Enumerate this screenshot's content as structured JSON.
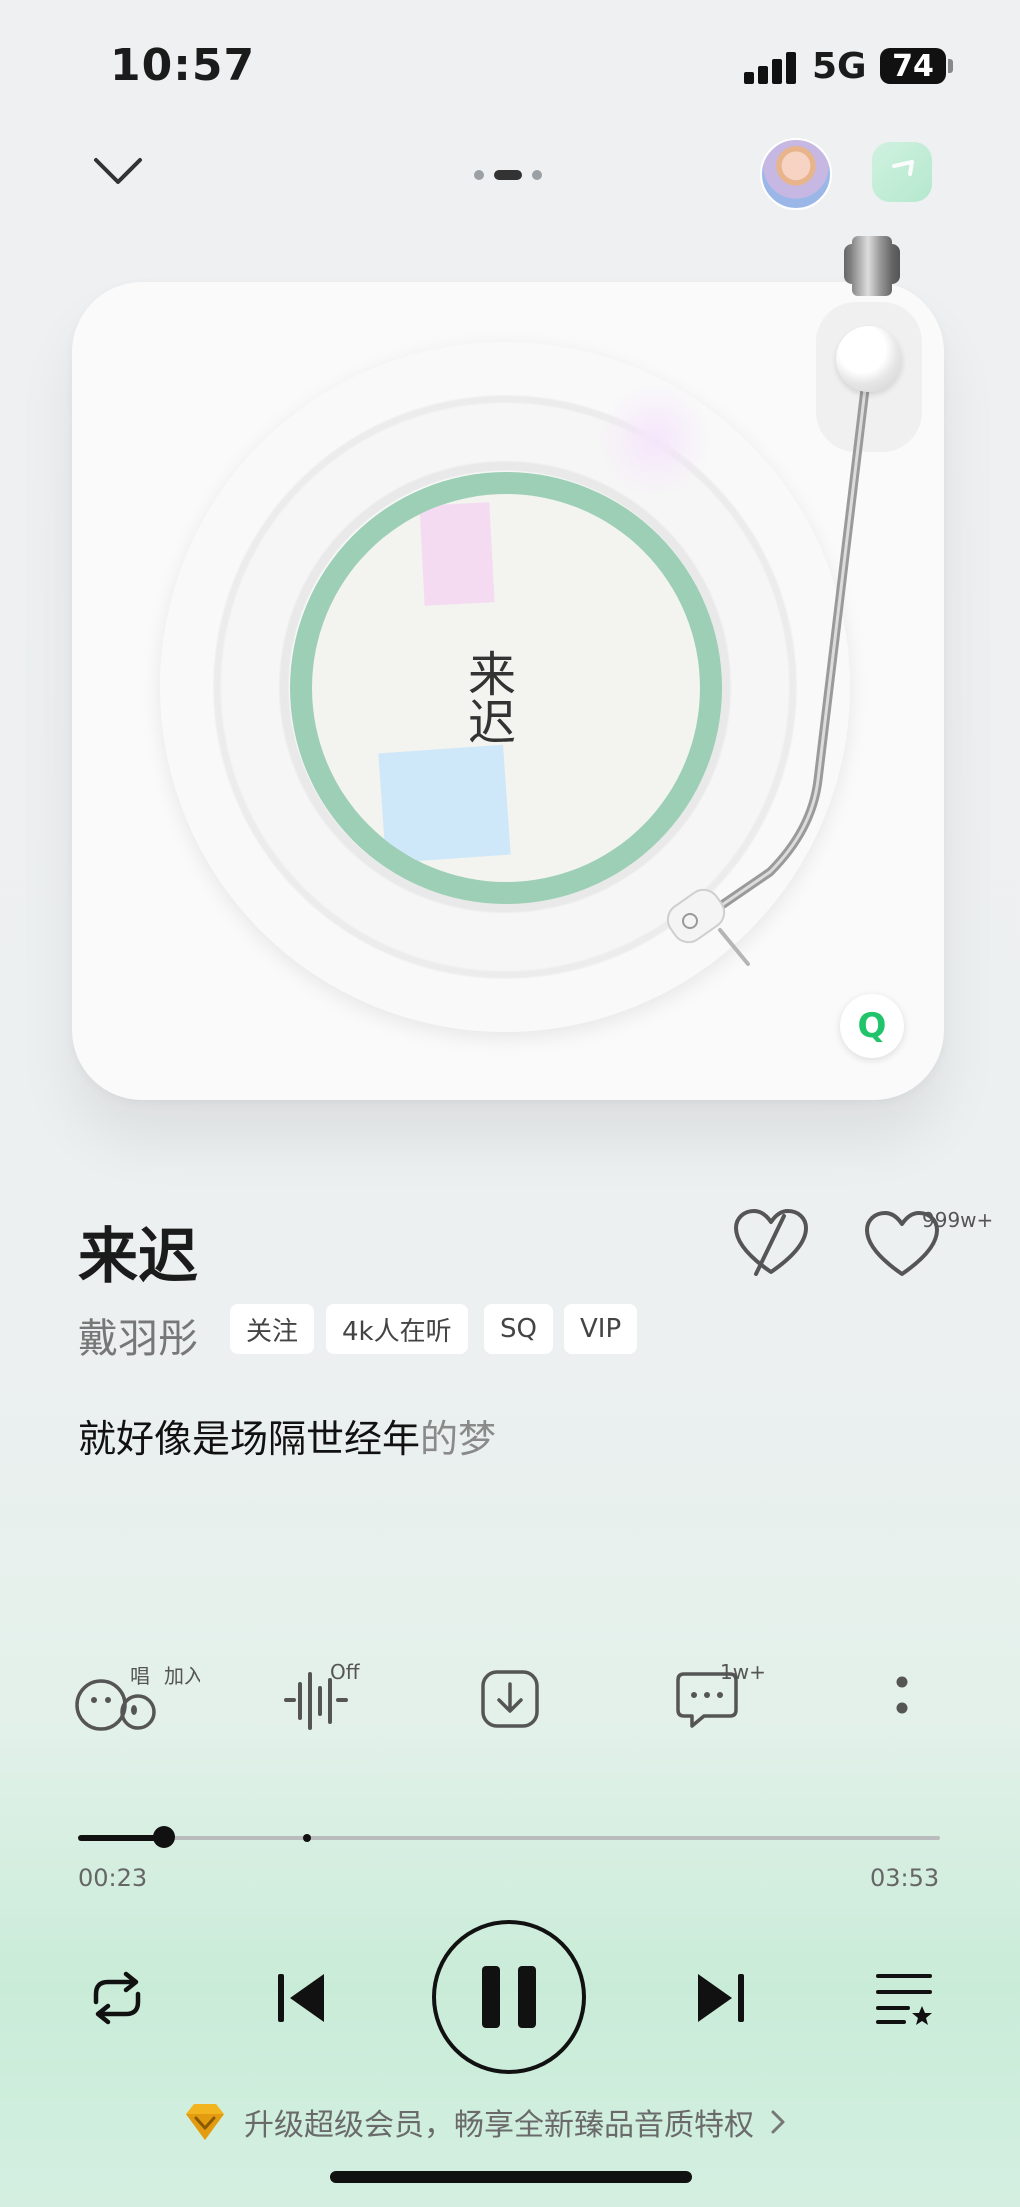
{
  "status_bar": {
    "time": "10:57",
    "network": "5G",
    "battery": "74"
  },
  "player": {
    "song_title": "来迟",
    "cover_title": "来迟",
    "artist": "戴羽彤",
    "tags": [
      "关注",
      "4k人在听",
      "SQ",
      "VIP"
    ],
    "like_count": "999w+",
    "lyric_sung": "就好像是场隔世经年",
    "lyric_rest": "的梦"
  },
  "actions": {
    "sing_badge": "唱",
    "join_badge": "加入",
    "effect_badge": "Off",
    "comment_badge": "1w+"
  },
  "progress": {
    "current": "00:23",
    "total": "03:53",
    "fraction": 0.1
  },
  "promo": {
    "text": "升级超级会员，畅享全新臻品音质特权"
  },
  "colors": {
    "accent_green": "#21c46b",
    "label_ring": "#9ccfb5"
  }
}
